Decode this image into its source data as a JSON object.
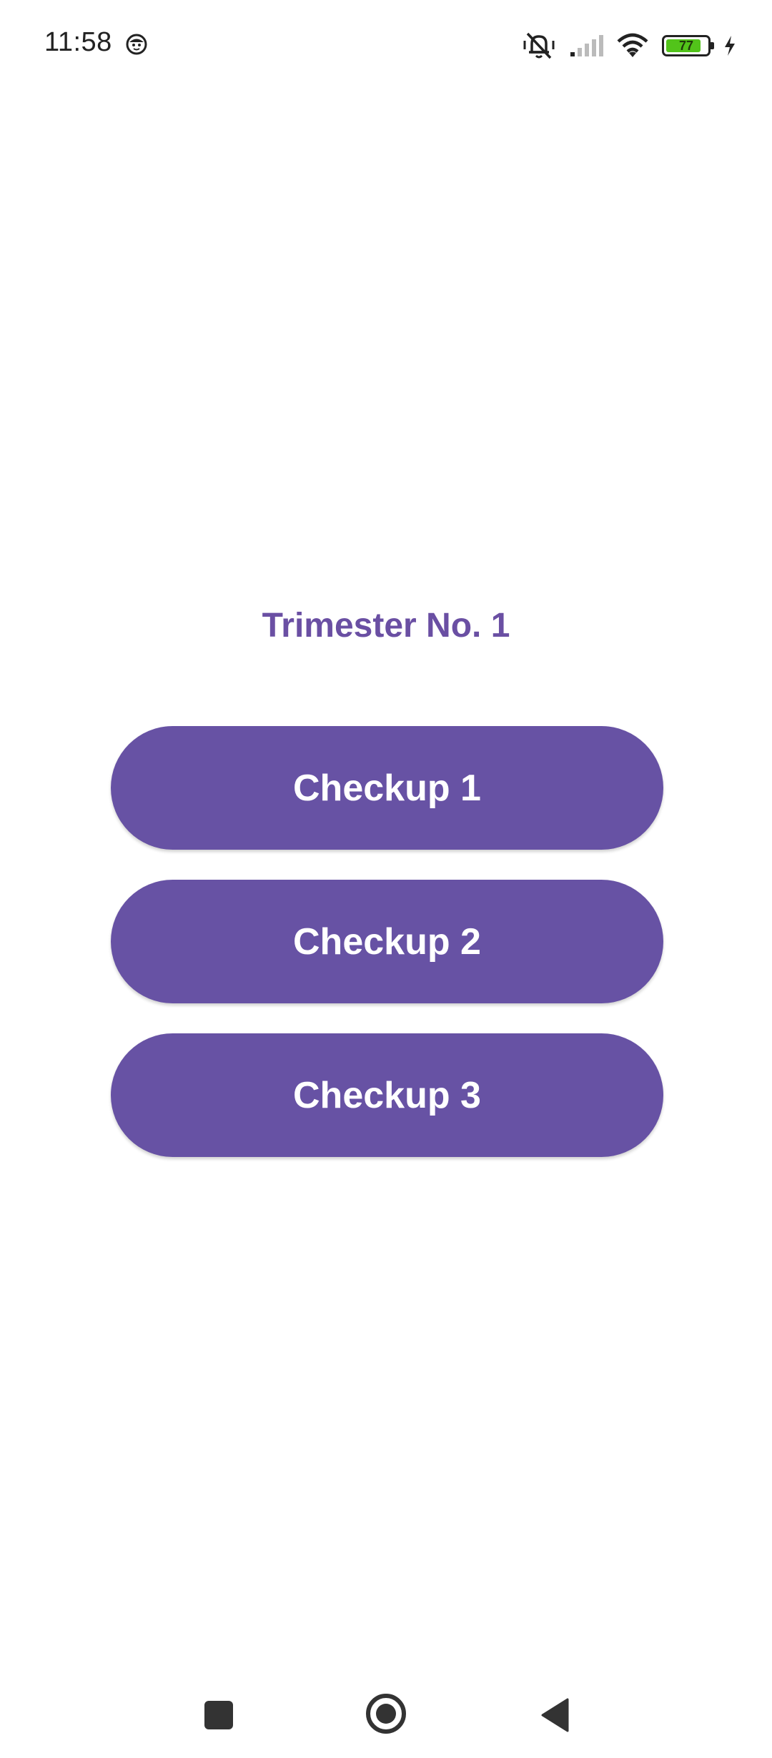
{
  "status_bar": {
    "time": "11:58",
    "face_icon": "face-icon",
    "mute_icon": "vibrate-off-icon",
    "signal_icon": "signal-icon",
    "wifi_icon": "wifi-icon",
    "battery_level": "77",
    "battery_color": "#52C41A",
    "charging_icon": "bolt-icon"
  },
  "main": {
    "title": "Trimester No. 1",
    "buttons": [
      {
        "label": "Checkup 1"
      },
      {
        "label": "Checkup 2"
      },
      {
        "label": "Checkup 3"
      }
    ]
  },
  "colors": {
    "accent": "#6752A4",
    "title": "#6A4FA3",
    "background": "#FFFFFF"
  },
  "nav_bar": {
    "recents_icon": "square-icon",
    "home_icon": "circle-icon",
    "back_icon": "triangle-back-icon"
  }
}
